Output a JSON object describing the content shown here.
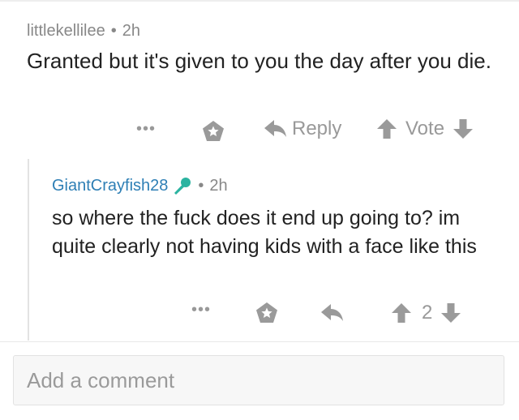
{
  "parent_comment": {
    "username": "littlekellilee",
    "separator": "•",
    "age": "2h",
    "body": "Granted but it's given to you the day after you die.",
    "actions": {
      "more_label": "•••",
      "award_icon": "pentagon-star-icon",
      "reply_label": "Reply",
      "vote_label": "Vote"
    }
  },
  "reply_comment": {
    "username": "GiantCrayfish28",
    "flair_icon": "microphone-icon",
    "separator": "•",
    "age": "2h",
    "body": "so where the fuck does it end up going to? im quite clearly not having kids with a face like this",
    "actions": {
      "more_label": "•••",
      "award_icon": "pentagon-star-icon",
      "score": "2"
    }
  },
  "comment_input": {
    "placeholder": "Add a comment"
  },
  "colors": {
    "username_link": "#2e7fb5",
    "action_gray": "#999999",
    "mic_teal": "#2bb3a0"
  }
}
